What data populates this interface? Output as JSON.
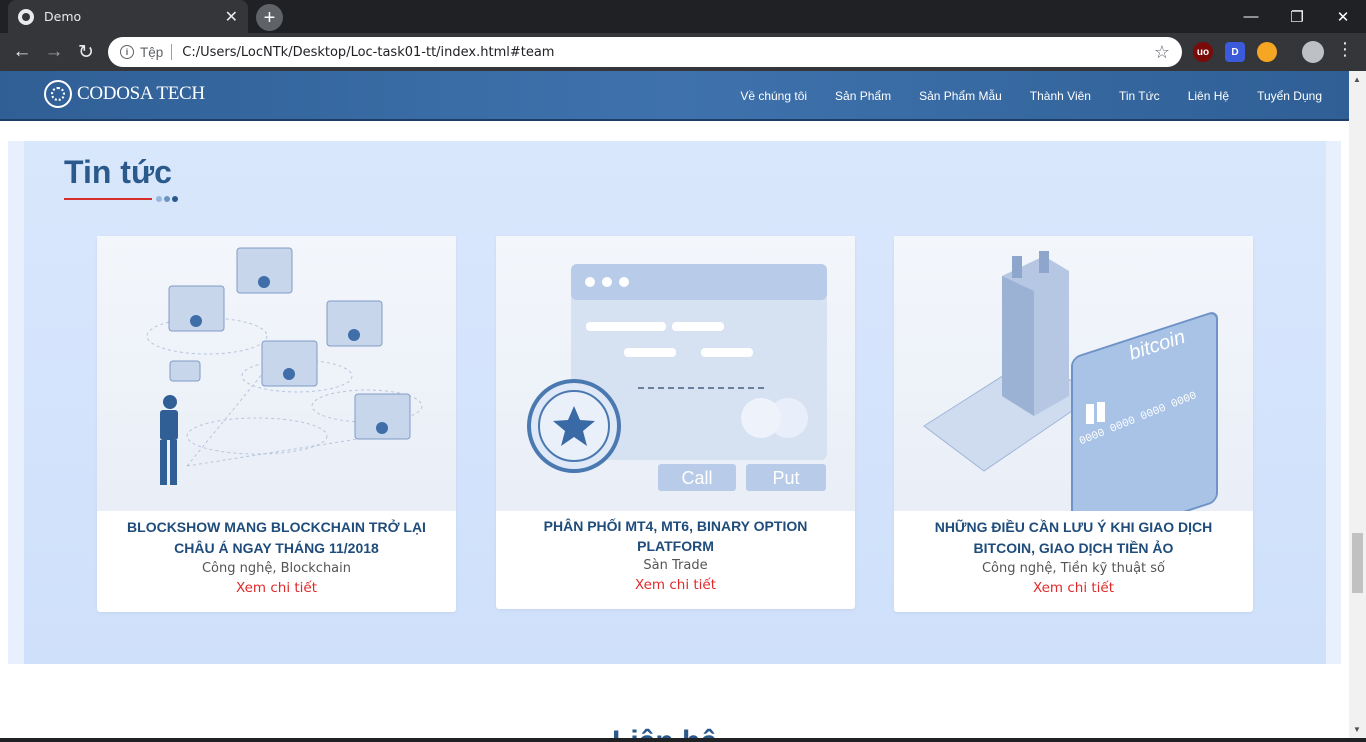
{
  "browser": {
    "tab_title": "Demo",
    "tab_close": "✕",
    "new_tab": "+",
    "url_protocol_label": "Tệp",
    "url": "C:/Users/LocNTk/Desktop/Loc-task01-tt/index.html#team",
    "extensions": [
      {
        "name": "ublock-icon",
        "label": "uo",
        "color": "#8b0000"
      },
      {
        "name": "d-extension-icon",
        "label": "D",
        "color": "#3b5bdb"
      },
      {
        "name": "owl-extension-icon",
        "label": "👀",
        "color": "#f5a623"
      }
    ]
  },
  "site": {
    "logo_text": "CODOSA TECH",
    "nav": [
      "Về chúng tôi",
      "Sản Phẩm",
      "Sản Phẩm Mẫu",
      "Thành Viên",
      "Tin Tức",
      "Liên Hệ",
      "Tuyển Dụng"
    ]
  },
  "news": {
    "heading": "Tin tức",
    "dot_colors": [
      "#8fb0d8",
      "#6b93c4",
      "#2a5a8c"
    ],
    "cards": [
      {
        "title": "BLOCKSHOW MANG BLOCKCHAIN TRỞ LẠI CHÂU Á NGAY THÁNG 11/2018",
        "category": "Công nghệ, Blockchain",
        "more": "Xem chi tiết",
        "image": "network-people-illustration"
      },
      {
        "title": "PHÂN PHỐI MT4, MT6, BINARY OPTION PLATFORM",
        "category": "Sàn Trade",
        "more": "Xem chi tiết",
        "image": "trading-platform-illustration",
        "buttons": [
          "Call",
          "Put"
        ]
      },
      {
        "title": "NHỮNG ĐIỀU CẦN LƯU Ý KHI GIAO DỊCH BITCOIN, GIAO DỊCH TIỀN ẢO",
        "category": "Công nghệ, Tiền kỹ thuật số",
        "more": "Xem chi tiết",
        "image": "bitcoin-card-illustration",
        "card_text": "bitcoin",
        "card_number": "0000 0000 0000 0000"
      }
    ]
  },
  "next_section_heading": "Liên hệ"
}
